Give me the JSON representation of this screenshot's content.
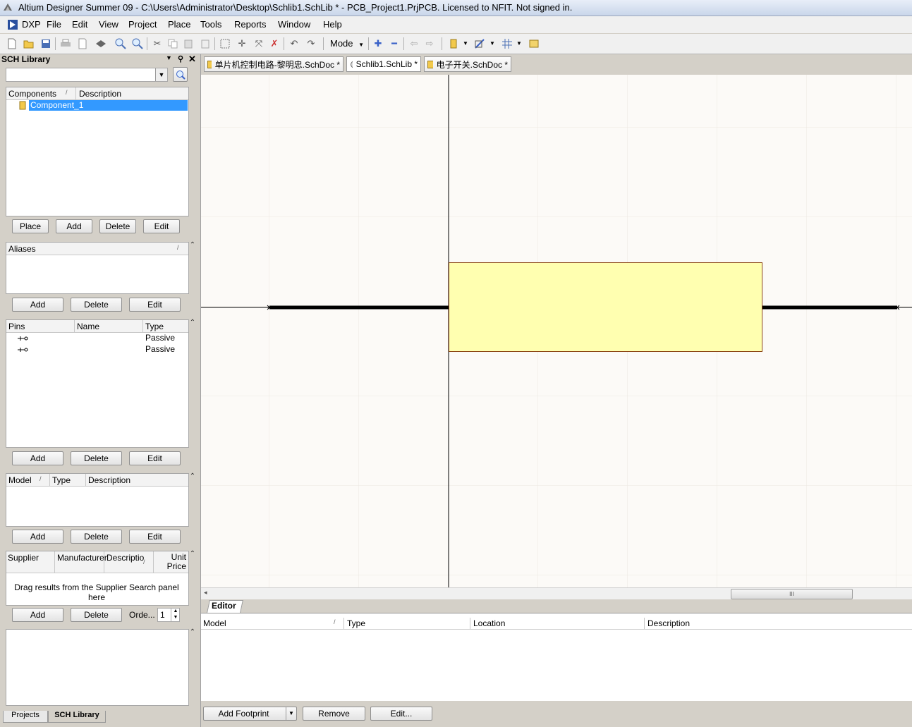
{
  "window": {
    "title": "Altium Designer Summer 09 - C:\\Users\\Administrator\\Desktop\\Schlib1.SchLib * - PCB_Project1.PrjPCB. Licensed to NFIT. Not signed in."
  },
  "menu": [
    "DXP",
    "File",
    "Edit",
    "View",
    "Project",
    "Place",
    "Tools",
    "Reports",
    "Window",
    "Help"
  ],
  "toolbar": {
    "mode_label": "Mode"
  },
  "sch_library": {
    "title": "SCH Library",
    "search_value": "",
    "components": {
      "headers": [
        "Components",
        "Description"
      ],
      "items": [
        {
          "name": "Component_1",
          "description": ""
        }
      ],
      "buttons": [
        "Place",
        "Add",
        "Delete",
        "Edit"
      ]
    },
    "aliases": {
      "header": "Aliases",
      "buttons": [
        "Add",
        "Delete",
        "Edit"
      ]
    },
    "pins": {
      "headers": [
        "Pins",
        "Name",
        "Type"
      ],
      "rows": [
        {
          "pin": "",
          "name": "",
          "type": "Passive"
        },
        {
          "pin": "",
          "name": "",
          "type": "Passive"
        }
      ],
      "buttons": [
        "Add",
        "Delete",
        "Edit"
      ]
    },
    "model": {
      "headers": [
        "Model",
        "Type",
        "Description"
      ],
      "buttons": [
        "Add",
        "Delete",
        "Edit"
      ]
    },
    "supplier": {
      "headers": [
        "Supplier",
        "Manufacturer",
        "Descriptio",
        "Unit Price"
      ],
      "drag_hint": "Drag results from the Supplier Search panel here",
      "buttons": [
        "Add",
        "Delete"
      ],
      "order_label": "Orde...",
      "order_value": "1"
    },
    "bottom_tabs": [
      "Projects",
      "SCH Library"
    ]
  },
  "document_tabs": [
    {
      "label": "单片机控制电路-黎明忠.SchDoc *"
    },
    {
      "label": "Schlib1.SchLib *"
    },
    {
      "label": "电子开关.SchDoc *"
    }
  ],
  "scrollbar": {
    "thumb_label": "III"
  },
  "editor_panel": {
    "tab": "Editor",
    "headers": [
      "Model",
      "Type",
      "Location",
      "Description"
    ],
    "buttons": {
      "add_footprint": "Add Footprint",
      "remove": "Remove",
      "edit": "Edit..."
    }
  },
  "colors": {
    "component_fill": "#ffffb0",
    "component_border": "#8b4513",
    "selection": "#3399ff",
    "canvas": "#fcfaf7",
    "grid": "#ece8e2"
  }
}
